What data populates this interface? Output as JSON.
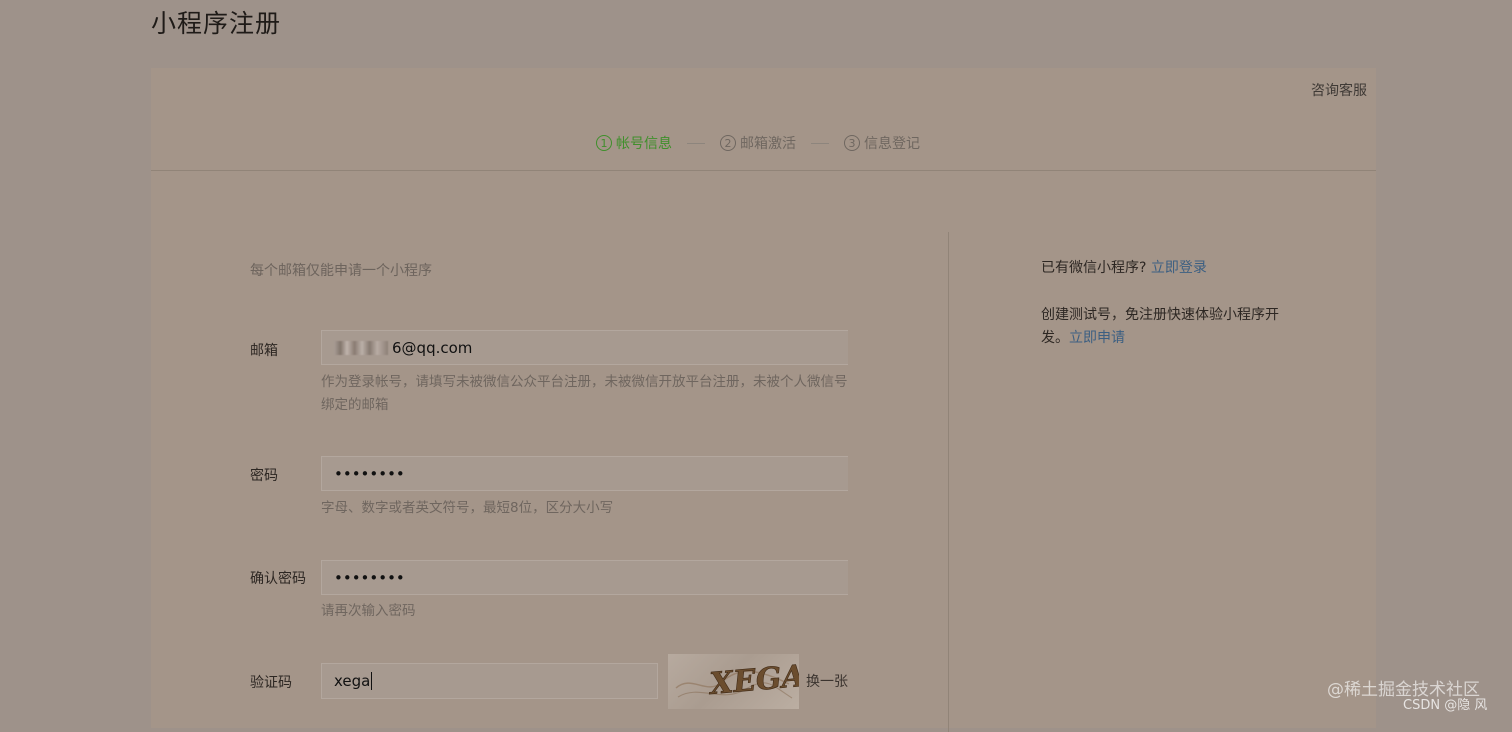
{
  "page": {
    "title": "小程序注册",
    "support": "咨询客服"
  },
  "steps": [
    {
      "num": "1",
      "label": "帐号信息",
      "active": true
    },
    {
      "num": "2",
      "label": "邮箱激活",
      "active": false
    },
    {
      "num": "3",
      "label": "信息登记",
      "active": false
    }
  ],
  "form": {
    "note": "每个邮箱仅能申请一个小程序",
    "email_label": "邮箱",
    "email_value_visible": "6@qq.com",
    "email_hint": "作为登录帐号，请填写未被微信公众平台注册，未被微信开放平台注册，未被个人微信号绑定的邮箱",
    "password_label": "密码",
    "password_value": "••••••••",
    "password_hint": "字母、数字或者英文符号，最短8位，区分大小写",
    "confirm_label": "确认密码",
    "confirm_value": "••••••••",
    "confirm_hint": "请再次输入密码",
    "captcha_label": "验证码",
    "captcha_value": "xega",
    "captcha_image_text": "XEGA",
    "change_captcha": "换一张"
  },
  "side": {
    "login_text": "已有微信小程序?",
    "login_link": "立即登录",
    "test_text": "创建测试号，免注册快速体验小程序开发。",
    "apply_link": "立即申请"
  },
  "watermarks": {
    "line1": "@稀土掘金技术社区",
    "line2": "CSDN @隐 风"
  },
  "colors": {
    "active_step": "#3f8f2b",
    "link": "#3c5f82"
  }
}
